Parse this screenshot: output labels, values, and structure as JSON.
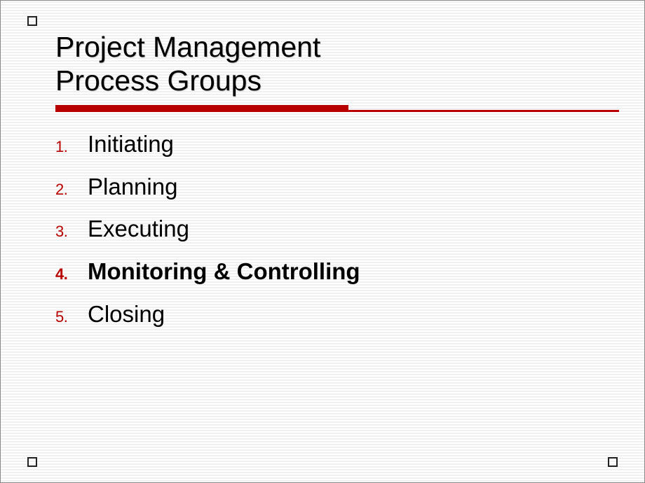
{
  "title": {
    "line1": "Project Management",
    "line2": "Process Groups"
  },
  "list": [
    {
      "num": "1.",
      "text": "Initiating",
      "bold": false
    },
    {
      "num": "2.",
      "text": "Planning",
      "bold": false
    },
    {
      "num": "3.",
      "text": "Executing",
      "bold": false
    },
    {
      "num": "4.",
      "text": "Monitoring & Controlling",
      "bold": true
    },
    {
      "num": "5.",
      "text": "Closing",
      "bold": false
    }
  ]
}
